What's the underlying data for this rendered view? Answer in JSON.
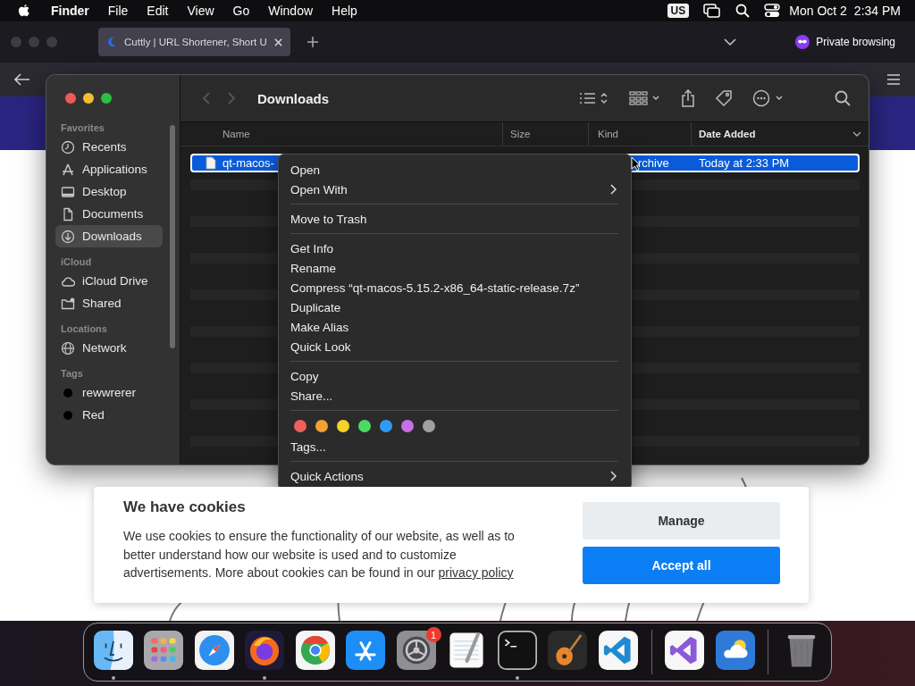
{
  "menu_bar": {
    "app": "Finder",
    "menus": [
      "File",
      "Edit",
      "View",
      "Go",
      "Window",
      "Help"
    ],
    "input_source": "US",
    "date": "Mon Oct 2",
    "time": "2:34 PM"
  },
  "browser": {
    "tab": {
      "title": "Cuttly | URL Shortener, Short U",
      "selected": true
    },
    "private_label": "Private browsing"
  },
  "finder": {
    "title": "Downloads",
    "sidebar": [
      {
        "title": "Favorites",
        "items": [
          {
            "label": "Recents",
            "selected": false
          },
          {
            "label": "Applications",
            "selected": false
          },
          {
            "label": "Desktop",
            "selected": false
          },
          {
            "label": "Documents",
            "selected": false
          },
          {
            "label": "Downloads",
            "selected": true
          }
        ]
      },
      {
        "title": "iCloud",
        "items": [
          {
            "label": "iCloud Drive",
            "selected": false
          },
          {
            "label": "Shared",
            "selected": false
          }
        ]
      },
      {
        "title": "Locations",
        "items": [
          {
            "label": "Network",
            "selected": false
          }
        ]
      },
      {
        "title": "Tags",
        "items": [
          {
            "label": "rewwrerer",
            "color": "#000000",
            "selected": false
          },
          {
            "label": "Red",
            "color": "#000000",
            "selected": false
          }
        ]
      }
    ],
    "columns": [
      {
        "label": "Name",
        "sorted": false
      },
      {
        "label": "Size",
        "sorted": false
      },
      {
        "label": "Kind",
        "sorted": false
      },
      {
        "label": "Date Added",
        "sorted": true
      }
    ],
    "rows": [
      {
        "name": "qt-macos-",
        "kind": "rchive",
        "date_added": "Today at 2:33 PM",
        "selected": true
      }
    ]
  },
  "context_menu": [
    {
      "kind": "item",
      "label": "Open",
      "submenu": false
    },
    {
      "kind": "item",
      "label": "Open With",
      "submenu": true
    },
    {
      "kind": "separator"
    },
    {
      "kind": "item",
      "label": "Move to Trash",
      "submenu": false
    },
    {
      "kind": "separator"
    },
    {
      "kind": "item",
      "label": "Get Info",
      "submenu": false
    },
    {
      "kind": "item",
      "label": "Rename",
      "submenu": false
    },
    {
      "kind": "item",
      "label": "Compress “qt-macos-5.15.2-x86_64-static-release.7z”",
      "submenu": false
    },
    {
      "kind": "item",
      "label": "Duplicate",
      "submenu": false
    },
    {
      "kind": "item",
      "label": "Make Alias",
      "submenu": false
    },
    {
      "kind": "item",
      "label": "Quick Look",
      "submenu": false
    },
    {
      "kind": "separator"
    },
    {
      "kind": "item",
      "label": "Copy",
      "submenu": false
    },
    {
      "kind": "item",
      "label": "Share...",
      "submenu": false
    },
    {
      "kind": "separator"
    },
    {
      "kind": "tags",
      "colors": [
        {
          "color": "#f0605a"
        },
        {
          "color": "#f5a030"
        },
        {
          "color": "#f5d327"
        },
        {
          "color": "#4cd964"
        },
        {
          "color": "#2f9bf5"
        },
        {
          "color": "#c770e8"
        },
        {
          "color": "#a0a0a0"
        }
      ]
    },
    {
      "kind": "item",
      "label": "Tags...",
      "submenu": false
    },
    {
      "kind": "separator"
    },
    {
      "kind": "item",
      "label": "Quick Actions",
      "submenu": true
    }
  ],
  "cookie_banner": {
    "title": "We have cookies",
    "text": "We use cookies to ensure the functionality of our website, as well as to better understand how our website is used and to customize advertisements. More about cookies can be found in our",
    "link": "privacy policy",
    "buttons": [
      {
        "label": "Manage",
        "kind": "secondary"
      },
      {
        "label": "Accept all",
        "kind": "primary"
      }
    ]
  },
  "dock": [
    {
      "kind": "finder",
      "running": true
    },
    {
      "kind": "launchpad"
    },
    {
      "kind": "safari"
    },
    {
      "kind": "firefox",
      "running": true
    },
    {
      "kind": "chrome"
    },
    {
      "kind": "appstore"
    },
    {
      "kind": "settings",
      "badge": "1"
    },
    {
      "kind": "textedit"
    },
    {
      "kind": "terminal",
      "running": true
    },
    {
      "kind": "garageband"
    },
    {
      "kind": "vscode"
    },
    {
      "kind": "divider"
    },
    {
      "kind": "visualstudio"
    },
    {
      "kind": "weather"
    },
    {
      "kind": "divider"
    },
    {
      "kind": "trash"
    }
  ]
}
